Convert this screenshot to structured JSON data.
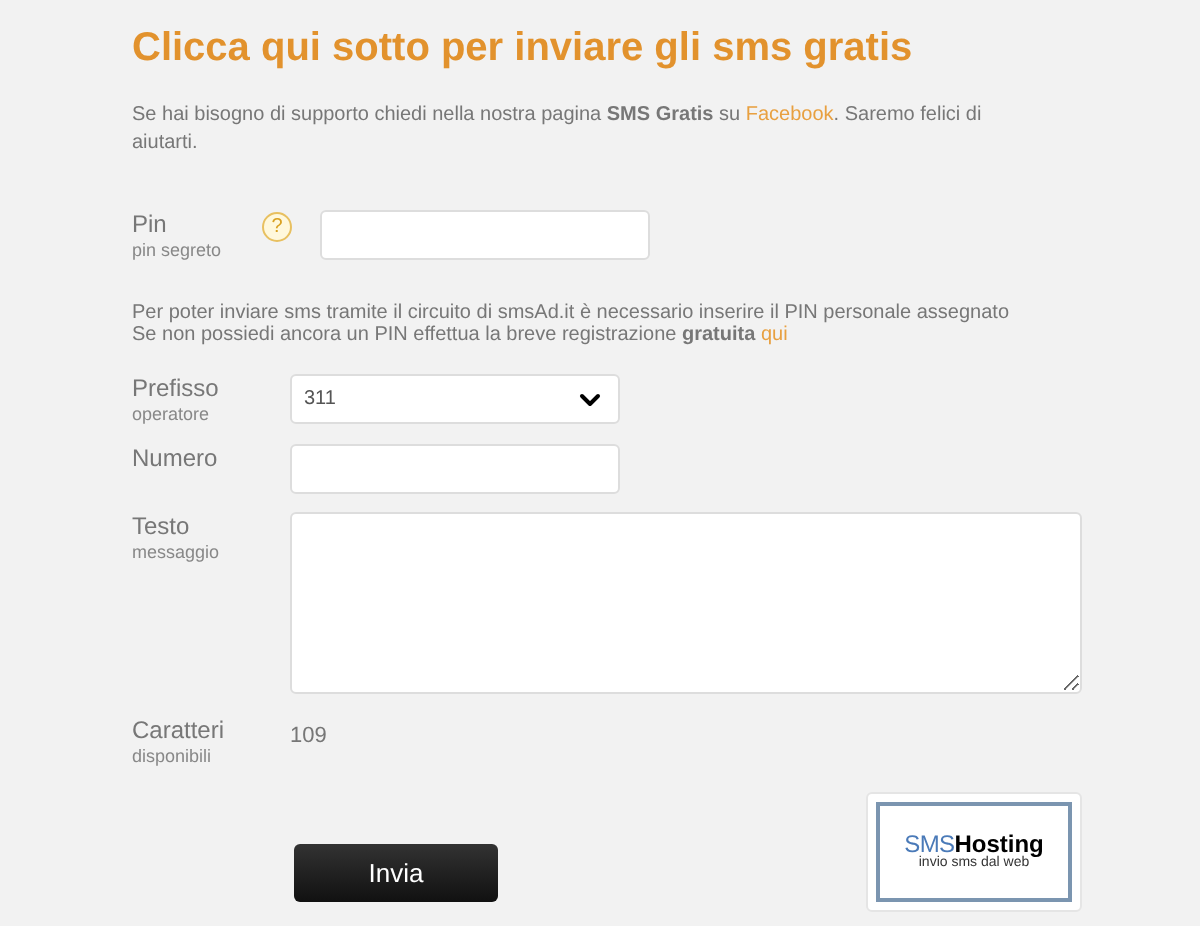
{
  "title": "Clicca qui sotto per inviare gli sms gratis",
  "intro": {
    "before": "Se hai bisogno di supporto chiedi nella nostra pagina **SMS Gratis** su ",
    "link": "Facebook",
    "after": ". Saremo felici di aiutarti."
  },
  "pin": {
    "label": "Pin",
    "sublabel": "pin segreto",
    "help": "?"
  },
  "note": {
    "line1": "Per poter inviare sms tramite il circuito di smsAd.it è necessario inserire il PIN personale assegnato",
    "line2": "Se non possiedi ancora un PIN effettua la breve registrazione **gratuita** ",
    "link": "qui"
  },
  "prefix": {
    "label": "Prefisso",
    "sublabel": "operatore",
    "value": "311"
  },
  "number": {
    "label": "Numero"
  },
  "message": {
    "label": "Testo",
    "sublabel": "messaggio"
  },
  "chars": {
    "label": "Caratteri",
    "sublabel": "disponibili",
    "value": "109"
  },
  "submit": "Invia",
  "logo": {
    "brand_a": "SMS",
    "brand_b": "Hosting",
    "tagline": "invio sms dal web"
  }
}
